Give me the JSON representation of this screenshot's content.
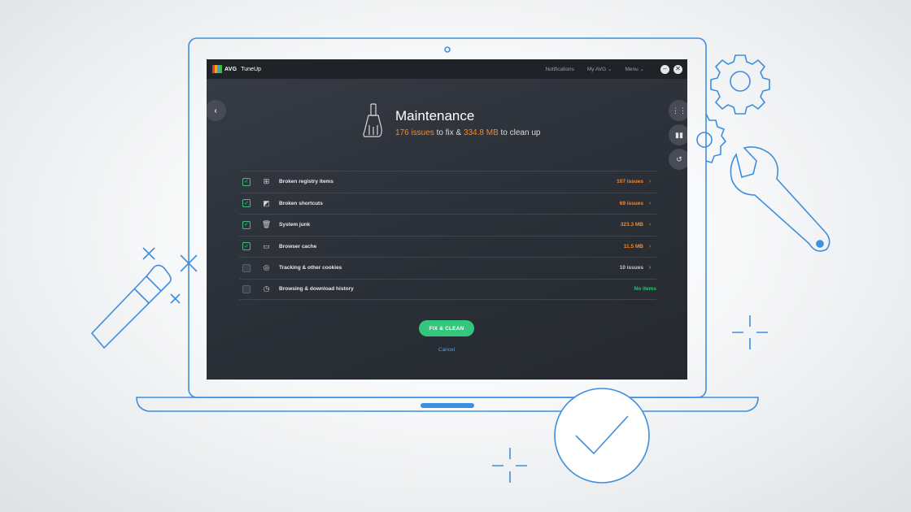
{
  "app": {
    "brand": "AVG",
    "product": "TuneUp",
    "logo_colors": [
      "#e03a3a",
      "#f7a21b",
      "#2ca8df",
      "#45b649"
    ]
  },
  "topnav": {
    "notifications": "Notifications",
    "my_avg": "My AVG ⌄",
    "menu": "Menu ⌄",
    "minimize": "–",
    "close": "✕"
  },
  "header": {
    "title": "Maintenance",
    "issues_count": "176 issues",
    "to_fix": " to fix & ",
    "size": "334.8 MB",
    "to_clean": " to clean up"
  },
  "items": [
    {
      "label": "Broken registry items",
      "value": "107 issues",
      "checked": true,
      "icon": "registry-icon",
      "status": "warn"
    },
    {
      "label": "Broken shortcuts",
      "value": "69 issues",
      "checked": true,
      "icon": "shortcut-icon",
      "status": "warn"
    },
    {
      "label": "System junk",
      "value": "323.3 MB",
      "checked": true,
      "icon": "trash-icon",
      "status": "warn"
    },
    {
      "label": "Browser cache",
      "value": "11.5 MB",
      "checked": true,
      "icon": "browser-icon",
      "status": "warn"
    },
    {
      "label": "Tracking & other cookies",
      "value": "10 issues",
      "checked": false,
      "icon": "cookie-icon",
      "status": "neutral"
    },
    {
      "label": "Browsing & download history",
      "value": "No items",
      "checked": false,
      "icon": "history-icon",
      "status": "ok"
    }
  ],
  "actions": {
    "fix_clean": "FIX & CLEAN",
    "cancel": "Cancel"
  },
  "colors": {
    "accent_green": "#34c67c",
    "warning_orange": "#f18a2b",
    "link_blue": "#4ba3e6",
    "line_blue": "#3d8fe0"
  }
}
